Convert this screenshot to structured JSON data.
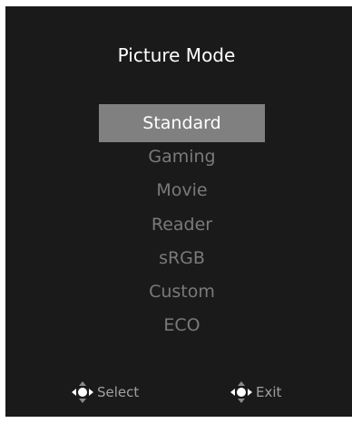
{
  "menu": {
    "title": "Picture Mode",
    "options": [
      {
        "label": "Standard",
        "selected": true
      },
      {
        "label": "Gaming",
        "selected": false
      },
      {
        "label": "Movie",
        "selected": false
      },
      {
        "label": "Reader",
        "selected": false
      },
      {
        "label": "sRGB",
        "selected": false
      },
      {
        "label": "Custom",
        "selected": false
      },
      {
        "label": "ECO",
        "selected": false
      }
    ]
  },
  "footer": {
    "select_label": "Select",
    "select_icon": "dpad-select-icon",
    "exit_label": "Exit",
    "exit_icon": "dpad-exit-icon"
  },
  "colors": {
    "background": "#1a1a1a",
    "highlight": "#808080",
    "inactive_text": "#7a7a7a",
    "accent": "#2d6f9a"
  }
}
